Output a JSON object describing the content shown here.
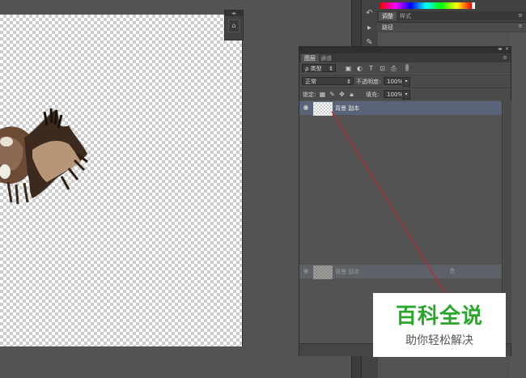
{
  "canvas": {
    "background": "transparent-checkerboard",
    "subject": "eagle cutout"
  },
  "color_panel": {
    "tabs": [
      "调整",
      "样式"
    ],
    "paths_label": "路径"
  },
  "layers_panel": {
    "tabs": [
      "图层",
      "通道"
    ],
    "filter": {
      "kind_label": "ρ 类型"
    },
    "blend_mode": "正常",
    "opacity": {
      "label": "不透明度:",
      "value": "100%"
    },
    "lock": {
      "label": "锁定:"
    },
    "fill": {
      "label": "填充:",
      "value": "100%"
    },
    "layers": [
      {
        "name": "背景 副本",
        "selected": true
      },
      {
        "name": "背景 副本",
        "selected": false,
        "dragging": true
      }
    ]
  },
  "watermark": {
    "title": "百科全说",
    "subtitle": "助你轻松解决",
    "color": "#2aa62a"
  },
  "colors": {
    "ui_bg": "#535353",
    "selection": "#5a6478",
    "annotation": "#c0272d"
  }
}
